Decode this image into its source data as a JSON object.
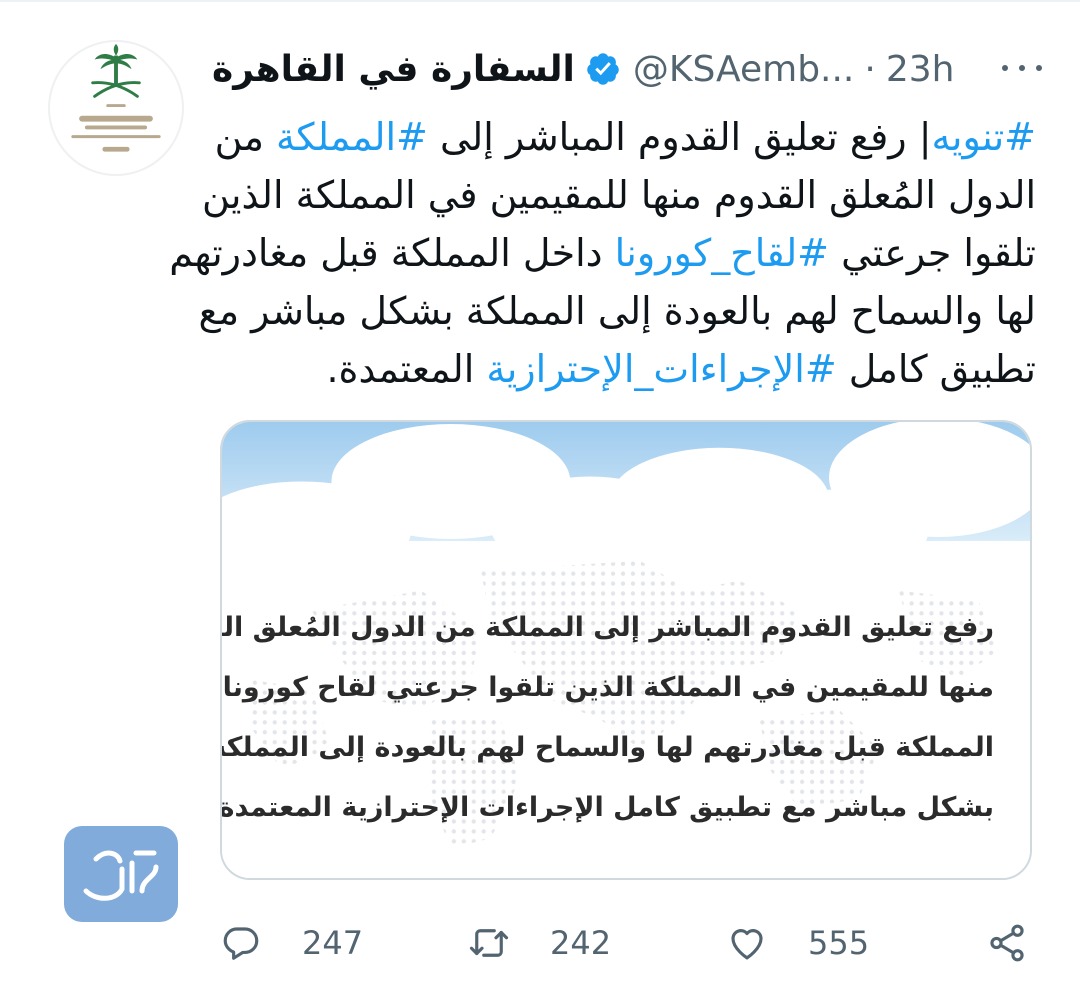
{
  "tweet": {
    "display_name": "السفارة في القاهرة",
    "handle": "@KSAemb...",
    "separator": "·",
    "time": "23h",
    "text_lines": [
      {
        "tag1": "#تنويه",
        "rest1": "| رفع تعليق القدوم المباشر إلى ",
        "tag2": "#المملكة",
        "rest2": " من"
      },
      {
        "text": "الدول المُعلق القدوم منها للمقيمين في المملكة الذين"
      },
      {
        "pre": "تلقوا جرعتي ",
        "tag": "#لقاح_كورونا",
        "post": " داخل المملكة قبل مغادرتهم"
      },
      {
        "text": "لها والسماح لهم بالعودة إلى المملكة بشكل مباشر مع"
      },
      {
        "pre": "تطبيق كامل ",
        "tag": "#الإجراءات_الإحترازية",
        "post": " المعتمدة."
      }
    ]
  },
  "media": {
    "lines": [
      "رفع تعليق القدوم المباشر إلى المملكة من الدول المُعلق القدوم",
      "منها للمقيمين في المملكة الذين تلقوا جرعتي لقاح كورونا داخل",
      "المملكة قبل مغادرتهم لها والسماح لهم بالعودة إلى المملكة",
      "بشكل مباشر مع تطبيق كامل الإجراءات الإحترازية المعتمدة."
    ]
  },
  "actions": {
    "reply_count": "247",
    "retweet_count": "242",
    "like_count": "555"
  },
  "icons": {
    "verified": "verified-badge-icon",
    "more": "more-options-icon",
    "reply": "reply-icon",
    "retweet": "retweet-icon",
    "like": "heart-icon",
    "share": "share-icon"
  },
  "colors": {
    "link": "#1d9bf0",
    "muted": "#536471",
    "text": "#0f1419",
    "avatar_green": "#1e6b3a"
  }
}
